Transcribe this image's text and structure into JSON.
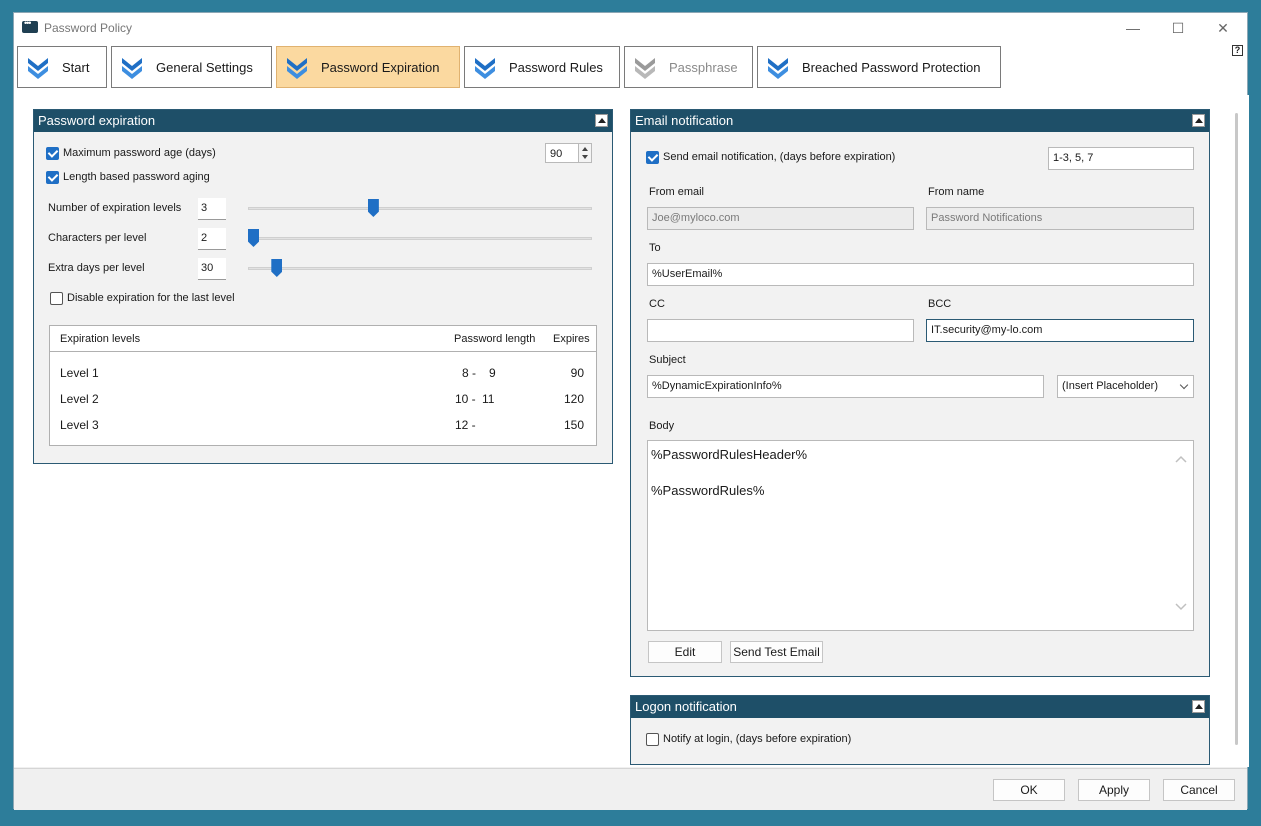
{
  "window": {
    "title": "Password Policy"
  },
  "tabs": [
    {
      "label": "Start"
    },
    {
      "label": "General Settings"
    },
    {
      "label": "Password Expiration"
    },
    {
      "label": "Password Rules"
    },
    {
      "label": "Passphrase"
    },
    {
      "label": "Breached Password Protection"
    }
  ],
  "help": "?",
  "expiration": {
    "title": "Password expiration",
    "max_age_label": "Maximum password age (days)",
    "max_age_value": "90",
    "length_aging_label": "Length based password aging",
    "levels_label": "Number of expiration levels",
    "levels_value": "3",
    "chars_label": "Characters per level",
    "chars_value": "2",
    "extra_label": "Extra days per level",
    "extra_value": "30",
    "disable_last_label": "Disable expiration for the last level",
    "sliders": {
      "levels_level": 0.36,
      "chars_level": 0.0,
      "extra_level": 0.07
    },
    "table": {
      "headers": [
        "Expiration levels",
        "Password length",
        "Expires"
      ],
      "rows": [
        {
          "level": "Level 1",
          "len_from": "8 -",
          "len_to": "9",
          "expires": "90"
        },
        {
          "level": "Level 2",
          "len_from": "10 -",
          "len_to": "11",
          "expires": "120"
        },
        {
          "level": "Level 3",
          "len_from": "12 -",
          "len_to": "",
          "expires": "150"
        }
      ]
    }
  },
  "email": {
    "title": "Email notification",
    "send_label": "Send email notification, (days before expiration)",
    "days_value": "1-3, 5, 7",
    "from_email_label": "From email",
    "from_email_value": "Joe@myloco.com",
    "from_name_label": "From name",
    "from_name_value": "Password Notifications",
    "to_label": "To",
    "to_value": "%UserEmail%",
    "cc_label": "CC",
    "cc_value": "",
    "bcc_label": "BCC",
    "bcc_value": "IT.security@my-lo.com",
    "subject_label": "Subject",
    "subject_value": "%DynamicExpirationInfo%",
    "placeholder_select": "(Insert Placeholder)",
    "body_label": "Body",
    "body_line1": "%PasswordRulesHeader%",
    "body_line2": "%PasswordRules%",
    "edit_label": "Edit",
    "test_label": "Send Test Email"
  },
  "logon": {
    "title": "Logon notification",
    "notify_label": "Notify at login, (days before expiration)"
  },
  "footer": {
    "ok": "OK",
    "apply": "Apply",
    "cancel": "Cancel"
  },
  "colors": {
    "accent": "#1f6fc5",
    "panel_header": "#1e4f68",
    "active_tab": "#fbd9a0"
  }
}
